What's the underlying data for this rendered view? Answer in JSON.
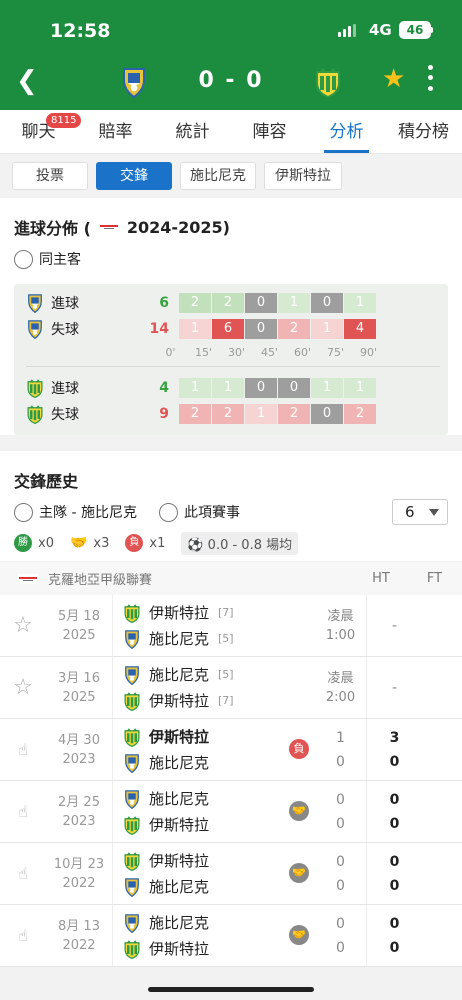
{
  "status": {
    "time": "12:58",
    "network": "4G",
    "battery": "46"
  },
  "header": {
    "score": "0 - 0"
  },
  "colors": {
    "brand": "#1c8c3e",
    "accent": "#1a73c8",
    "star": "#f7c11c",
    "loss": "#e05454"
  },
  "tabs": [
    {
      "label": "聊天",
      "badge": "8115"
    },
    {
      "label": "賠率"
    },
    {
      "label": "統計"
    },
    {
      "label": "陣容"
    },
    {
      "label": "分析",
      "active": true
    },
    {
      "label": "積分榜"
    }
  ],
  "subtabs": [
    {
      "label": "投票"
    },
    {
      "label": "交鋒",
      "active": true
    },
    {
      "label": "施比尼克"
    },
    {
      "label": "伊斯特拉"
    }
  ],
  "goal_dist": {
    "title": "進球分佈 (",
    "season": "2024-2025)",
    "option": "同主客",
    "ticks": [
      "0'",
      "15'",
      "30'",
      "45'",
      "60'",
      "75'",
      "90'"
    ],
    "rows": [
      {
        "label": "進球",
        "total": "6",
        "values": [
          "2",
          "2",
          "0",
          "1",
          "0",
          "1"
        ],
        "kind": "goal"
      },
      {
        "label": "失球",
        "total": "14",
        "values": [
          "1",
          "6",
          "0",
          "2",
          "1",
          "4"
        ],
        "kind": "loss"
      },
      {
        "label": "進球",
        "total": "4",
        "values": [
          "1",
          "1",
          "0",
          "0",
          "1",
          "1"
        ],
        "kind": "goal"
      },
      {
        "label": "失球",
        "total": "9",
        "values": [
          "2",
          "2",
          "1",
          "2",
          "0",
          "2"
        ],
        "kind": "loss"
      }
    ]
  },
  "h2h": {
    "title": "交鋒歷史",
    "option1": "主隊 - 施比尼克",
    "option2": "此項賽事",
    "count": "6",
    "win_label": "勝",
    "wins": "x0",
    "draws": "x3",
    "loss_label": "負",
    "losses": "x1",
    "avg": "0.0 - 0.8 場均",
    "league": "克羅地亞甲級聯賽",
    "ht_label": "HT",
    "ft_label": "FT"
  },
  "matches": [
    {
      "date": "5月 18",
      "year": "2025",
      "home": "伊斯特拉",
      "home_rank": "[7]",
      "away": "施比尼克",
      "away_rank": "[5]",
      "time1": "凌晨",
      "time2": "1:00",
      "ft": "-",
      "upcoming": true
    },
    {
      "date": "3月 16",
      "year": "2025",
      "home": "施比尼克",
      "home_rank": "[5]",
      "away": "伊斯特拉",
      "away_rank": "[7]",
      "time1": "凌晨",
      "time2": "2:00",
      "ft": "-",
      "upcoming": true
    },
    {
      "date": "4月 30",
      "year": "2023",
      "home": "伊斯特拉",
      "away": "施比尼克",
      "ht_home": "1",
      "ht_away": "0",
      "ft_home": "3",
      "ft_away": "0",
      "result": "負",
      "bold_home": true
    },
    {
      "date": "2月 25",
      "year": "2023",
      "home": "施比尼克",
      "away": "伊斯特拉",
      "ht_home": "0",
      "ht_away": "0",
      "ft_home": "0",
      "ft_away": "0",
      "result": "draw"
    },
    {
      "date": "10月 23",
      "year": "2022",
      "home": "伊斯特拉",
      "away": "施比尼克",
      "ht_home": "0",
      "ht_away": "0",
      "ft_home": "0",
      "ft_away": "0",
      "result": "draw"
    },
    {
      "date": "8月 13",
      "year": "2022",
      "home": "施比尼克",
      "away": "伊斯特拉",
      "ht_home": "0",
      "ht_away": "0",
      "ft_home": "0",
      "ft_away": "0",
      "result": "draw"
    }
  ]
}
